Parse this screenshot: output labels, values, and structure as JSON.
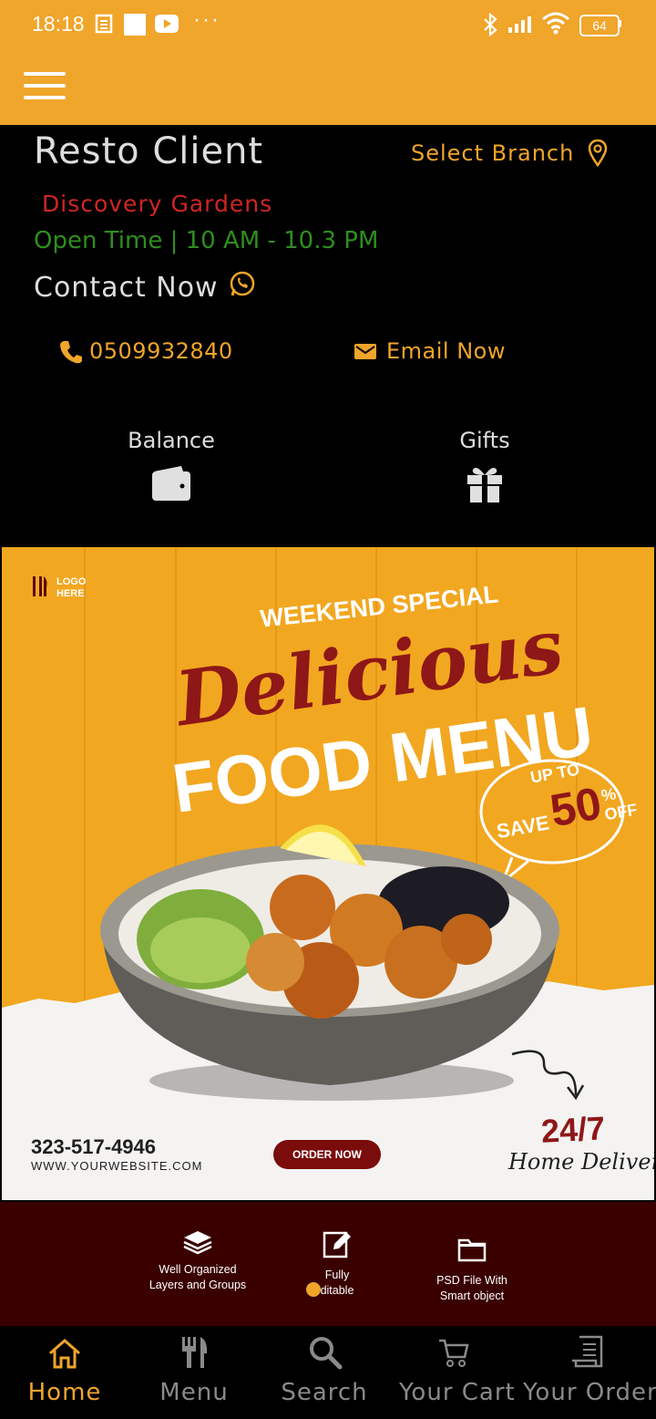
{
  "status_bar": {
    "time": "18:18",
    "battery": "64"
  },
  "header": {
    "app_title": "Resto Client",
    "select_branch": "Select Branch"
  },
  "branch": {
    "name": "Discovery Gardens",
    "open_time": "Open Time | 10 AM - 10.3 PM"
  },
  "contact": {
    "heading": "Contact Now",
    "phone": "0509932840",
    "email_label": "Email Now"
  },
  "stats": {
    "balance_label": "Balance",
    "gifts_label": "Gifts"
  },
  "banner": {
    "logo_line1": "LOGO",
    "logo_line2": "HERE",
    "weekend": "WEEKEND SPECIAL",
    "delicious": "Delicious",
    "food_menu": "FOOD MENU",
    "up_to": "UP TO",
    "save": "SAVE",
    "percent": "50",
    "percent_sign": "%",
    "off": "OFF",
    "phone": "323-517-4946",
    "website": "WWW.YOURWEBSITE.COM",
    "order_now": "ORDER NOW",
    "hours_247": "24/7",
    "home_delivery": "Home Delivery",
    "features": [
      {
        "line1": "Well Organized",
        "line2": "Layers and Groups"
      },
      {
        "line1": "Fully",
        "line2": "ditable"
      },
      {
        "line1": "PSD File With",
        "line2": "Smart object"
      }
    ]
  },
  "bottom_nav": [
    {
      "label": "Home",
      "icon": "home-icon",
      "active": true
    },
    {
      "label": "Menu",
      "icon": "utensils-icon",
      "active": false
    },
    {
      "label": "Search",
      "icon": "search-icon",
      "active": false
    },
    {
      "label": "Your Cart",
      "icon": "cart-icon",
      "active": false
    },
    {
      "label": "Your Orders",
      "icon": "receipt-icon",
      "active": false
    }
  ],
  "colors": {
    "accent": "#F0A52B",
    "branch_red": "#D12424",
    "hours_green": "#2F8E1F",
    "background": "#000000"
  }
}
